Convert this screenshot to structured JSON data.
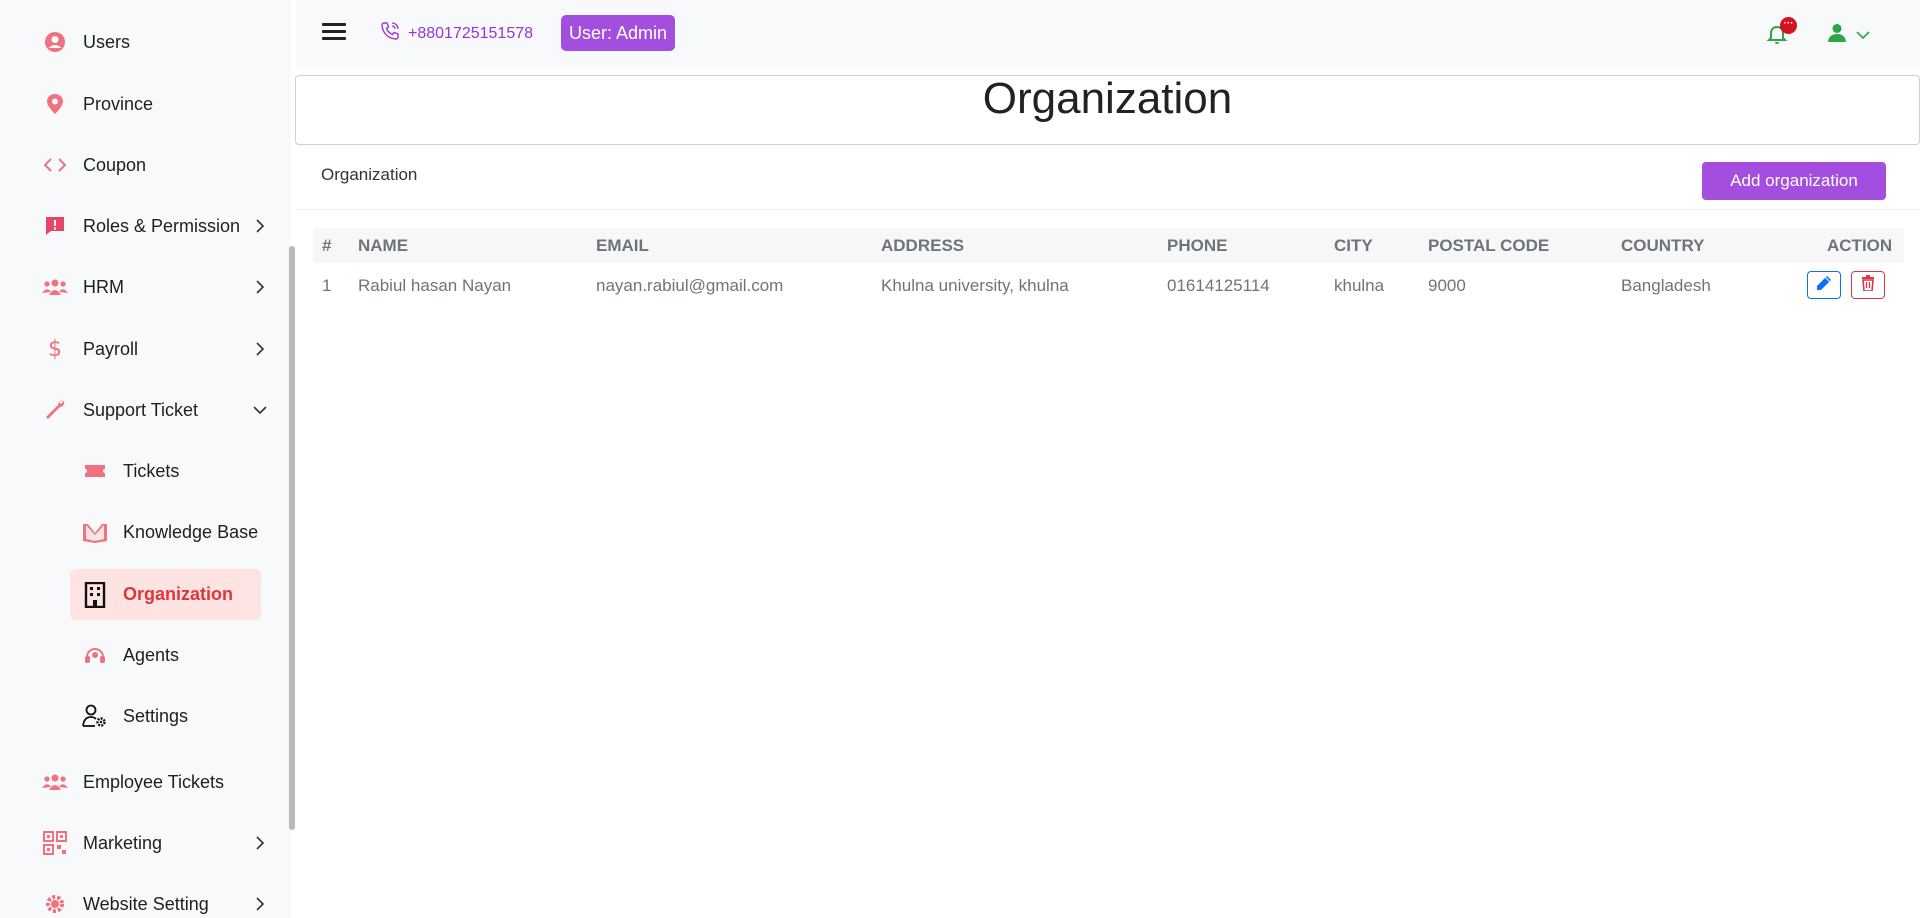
{
  "sidebar": {
    "items": [
      {
        "label": "Users"
      },
      {
        "label": "Province"
      },
      {
        "label": "Coupon"
      },
      {
        "label": "Roles & Permission"
      },
      {
        "label": "HRM"
      },
      {
        "label": "Payroll"
      },
      {
        "label": "Support Ticket"
      },
      {
        "label": "Tickets"
      },
      {
        "label": "Knowledge Base"
      },
      {
        "label": "Organization"
      },
      {
        "label": "Agents"
      },
      {
        "label": "Settings"
      },
      {
        "label": "Employee Tickets"
      },
      {
        "label": "Marketing"
      },
      {
        "label": "Website Setting"
      }
    ]
  },
  "topbar": {
    "phone": "+8801725151578",
    "user_badge": "User:  Admin",
    "notification_dot": "···"
  },
  "page": {
    "title": "Organization",
    "card_title": "Organization",
    "add_button": "Add organization"
  },
  "table": {
    "headers": [
      "#",
      "NAME",
      "EMAIL",
      "ADDRESS",
      "PHONE",
      "CITY",
      "POSTAL CODE",
      "COUNTRY",
      "ACTION"
    ],
    "rows": [
      [
        "1",
        "Rabiul hasan Nayan",
        "nayan.rabiul@gmail.com",
        "Khulna university, khulna",
        "01614125114",
        "khulna",
        "9000",
        "Bangladesh"
      ]
    ]
  },
  "colors": {
    "accent": "#a44ee0",
    "sidebar_icon": "#f0717f",
    "active_text": "#e0353b",
    "edit": "#0d6efd",
    "delete": "#dc3545"
  }
}
